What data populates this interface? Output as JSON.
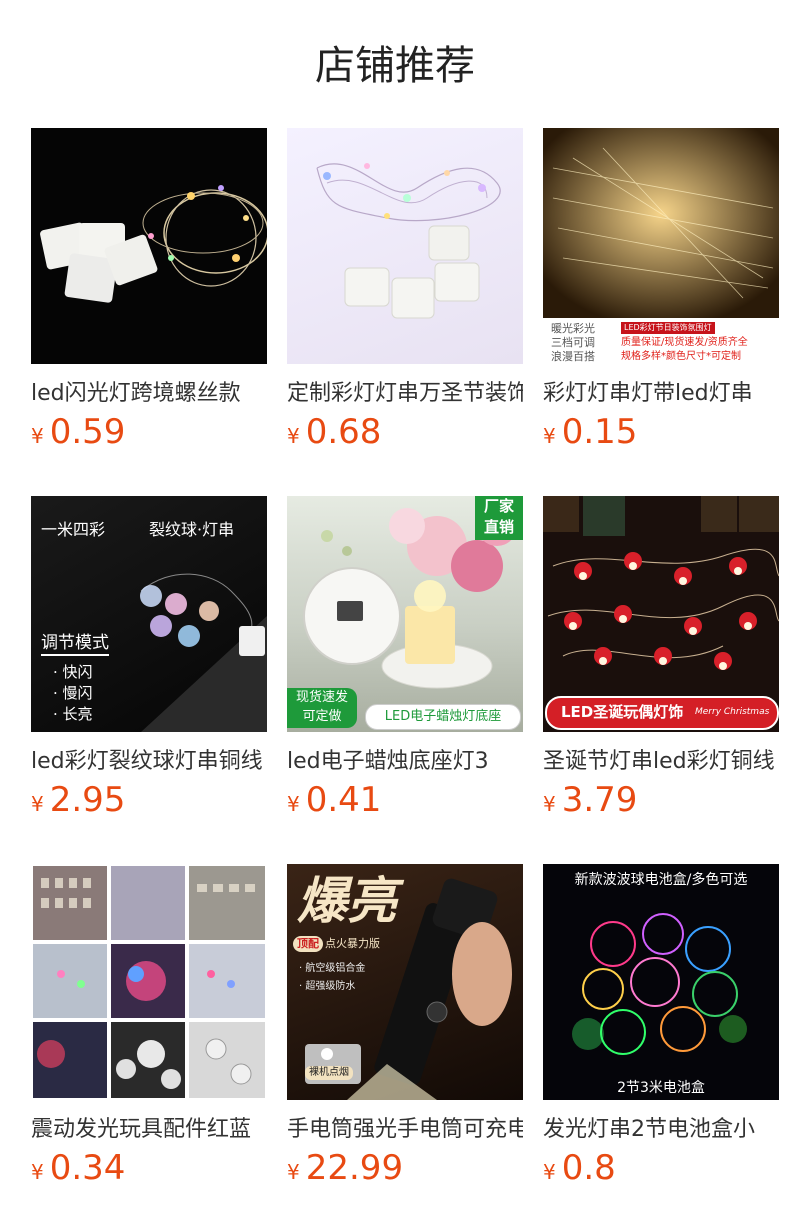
{
  "section": {
    "title": "店铺推荐"
  },
  "products": [
    {
      "name": "led闪光灯跨境螺丝款",
      "currency": "¥",
      "price": "0.59",
      "image_texts": []
    },
    {
      "name": "定制彩灯灯串万圣节装饰",
      "currency": "¥",
      "price": "0.68",
      "image_texts": []
    },
    {
      "name": "彩灯灯串灯带led灯串",
      "currency": "¥",
      "price": "0.15",
      "image_texts": [
        "暖光彩光",
        "三档可调",
        "浪漫百搭",
        "LED彩灯节日装饰氛围灯",
        "质量保证/现货速发/资质齐全",
        "规格多样*颜色尺寸*可定制"
      ]
    },
    {
      "name": "led彩灯裂纹球灯串铜线",
      "currency": "¥",
      "price": "2.95",
      "image_texts": [
        "一米四彩",
        "裂纹球·灯串",
        "调节模式",
        "· 快闪",
        "· 慢闪",
        "· 长亮"
      ]
    },
    {
      "name": "led电子蜡烛底座灯3",
      "currency": "¥",
      "price": "0.41",
      "image_texts": [
        "厂家",
        "直销",
        "现货速发",
        "可定做",
        "LED电子蜡烛灯底座"
      ]
    },
    {
      "name": "圣诞节灯串led彩灯铜线",
      "currency": "¥",
      "price": "3.79",
      "image_texts": [
        "LED圣诞玩偶灯饰",
        "Merry Christmas"
      ]
    },
    {
      "name": "震动发光玩具配件红蓝",
      "currency": "¥",
      "price": "0.34",
      "image_texts": []
    },
    {
      "name": "手电筒强光手电筒可充电",
      "currency": "¥",
      "price": "22.99",
      "image_texts": [
        "爆亮",
        "顶配",
        "点火暴力版",
        "· 航空级铝合金",
        "· 超强级防水",
        "裸机点烟"
      ]
    },
    {
      "name": "发光灯串2节电池盒小",
      "currency": "¥",
      "price": "0.8",
      "image_texts": [
        "新款波波球电池盒/多色可选",
        "2节3米电池盒"
      ]
    }
  ],
  "colors": {
    "price": "#e84a12",
    "title": "#222222"
  }
}
